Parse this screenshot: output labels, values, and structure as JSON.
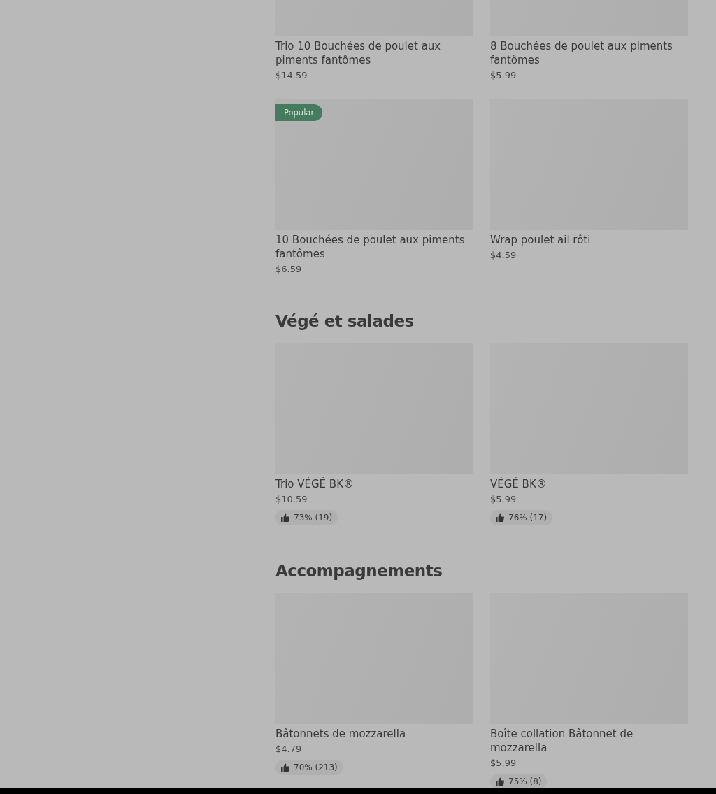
{
  "sections": [
    {
      "items": [
        {
          "name": "Trio 10 Bouchées de poulet aux piments fantômes",
          "price": "$14.59"
        },
        {
          "name": "8 Bouchées de poulet aux piments fantômes",
          "price": "$5.99"
        },
        {
          "name": "10 Bouchées de poulet aux piments fantômes",
          "price": "$6.59",
          "badge": "Popular"
        },
        {
          "name": "Wrap poulet ail rôti",
          "price": "$4.59"
        }
      ]
    },
    {
      "heading": "Végé et salades",
      "items": [
        {
          "name": "Trio VÉGÉ BK®",
          "price": "$10.59",
          "rating": "73% (19)"
        },
        {
          "name": "VÉGÉ BK®",
          "price": "$5.99",
          "rating": "76% (17)"
        }
      ]
    },
    {
      "heading": "Accompagnements",
      "items": [
        {
          "name": "Bâtonnets de mozzarella",
          "price": "$4.79",
          "rating": "70% (213)"
        },
        {
          "name": "Boîte collation Bâtonnet de mozzarella",
          "price": "$5.99",
          "rating": "75% (8)"
        }
      ]
    }
  ]
}
